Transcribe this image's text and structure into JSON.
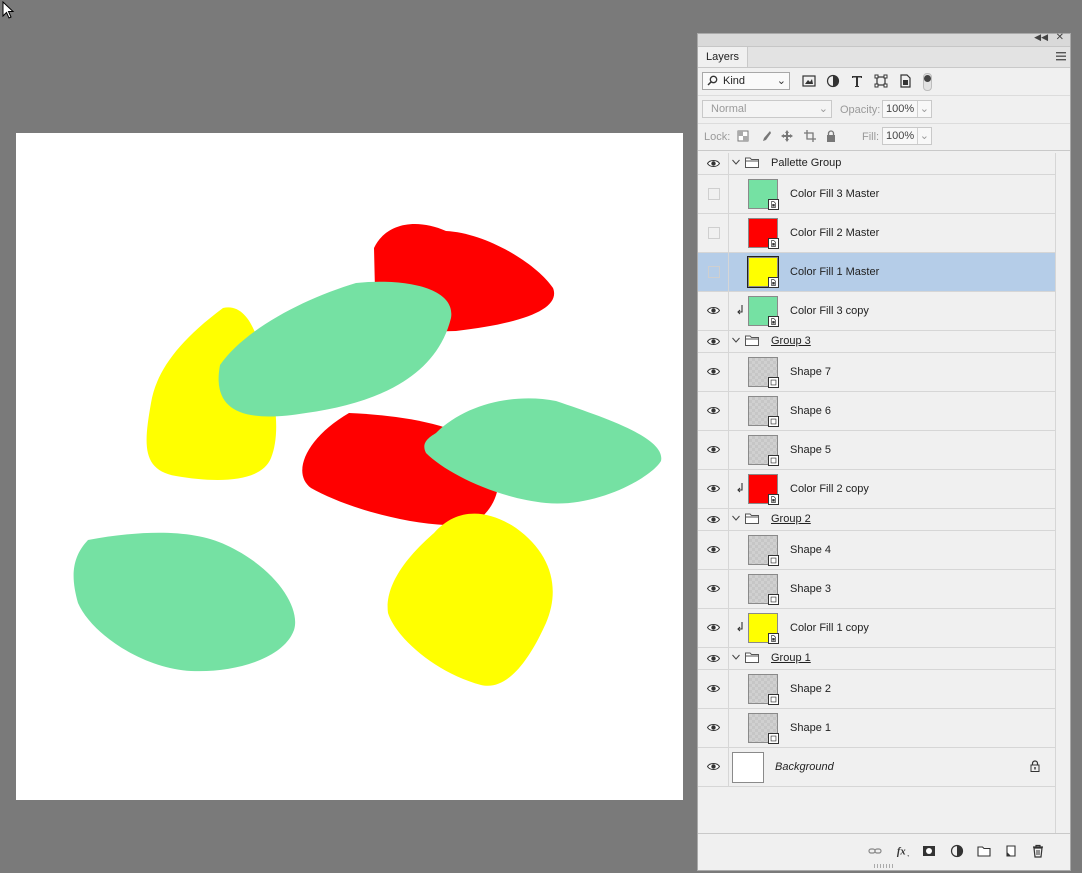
{
  "panel": {
    "tab_label": "Layers",
    "filter_kind": "Kind",
    "blend_mode": "Normal",
    "opacity_label": "Opacity:",
    "opacity_value": "100%",
    "lock_label": "Lock:",
    "fill_label": "Fill:",
    "fill_value": "100%"
  },
  "layers": [
    {
      "type": "group",
      "name": "Pallette Group",
      "visible": true
    },
    {
      "type": "fill",
      "name": "Color Fill 3 Master",
      "visible": false,
      "color": "#75e1a3"
    },
    {
      "type": "fill",
      "name": "Color Fill 2 Master",
      "visible": false,
      "color": "#ff0000"
    },
    {
      "type": "fill",
      "name": "Color Fill 1 Master",
      "visible": false,
      "color": "#ffff00",
      "selected": true
    },
    {
      "type": "fill",
      "name": "Color Fill 3  copy",
      "visible": true,
      "clipped": true,
      "color": "#75e1a3"
    },
    {
      "type": "group",
      "name": "Group 3",
      "visible": true
    },
    {
      "type": "shape",
      "name": "Shape 7",
      "visible": true
    },
    {
      "type": "shape",
      "name": "Shape 6",
      "visible": true
    },
    {
      "type": "shape",
      "name": "Shape 5",
      "visible": true
    },
    {
      "type": "fill",
      "name": "Color Fill 2  copy",
      "visible": true,
      "clipped": true,
      "color": "#ff0000"
    },
    {
      "type": "group",
      "name": "Group 2",
      "visible": true
    },
    {
      "type": "shape",
      "name": "Shape 4",
      "visible": true
    },
    {
      "type": "shape",
      "name": "Shape 3",
      "visible": true
    },
    {
      "type": "fill",
      "name": "Color Fill 1  copy",
      "visible": true,
      "clipped": true,
      "color": "#ffff00"
    },
    {
      "type": "group",
      "name": "Group 1",
      "visible": true
    },
    {
      "type": "shape",
      "name": "Shape 2",
      "visible": true
    },
    {
      "type": "shape",
      "name": "Shape 1",
      "visible": true
    },
    {
      "type": "background",
      "name": "Background",
      "visible": true
    }
  ],
  "colors": {
    "green": "#75e1a3",
    "red": "#ff0000",
    "yellow": "#ffff00",
    "selection": "#b5cde8"
  }
}
